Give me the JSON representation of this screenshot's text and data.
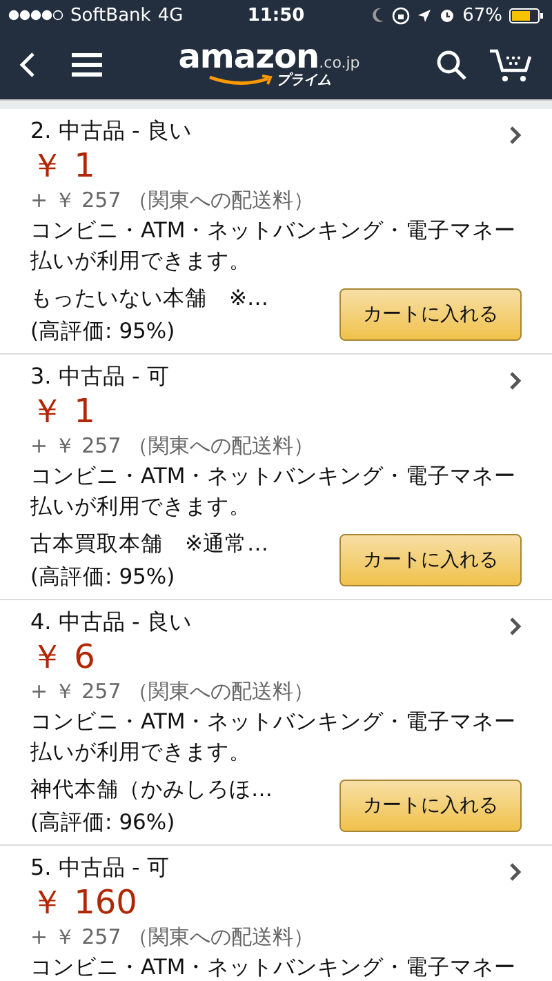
{
  "status_bar": {
    "carrier": "SoftBank",
    "network": "4G",
    "time": "11:50",
    "battery": "67%"
  },
  "nav": {
    "logo": "amazon",
    "logo_suffix": ".co.jp",
    "logo_sub": "プライム"
  },
  "listings": [
    {
      "title": "2. 中古品 - 良い",
      "price": "￥ 1",
      "shipping": "+ ￥ 257 （関東への配送料）",
      "payment_lines": [
        "コンビニ・ATM・ネットバンキング・電子マネー",
        "払いが利用できます。"
      ],
      "seller": "もったいない本舗　※…",
      "rating": "(高評価: 95%)",
      "button": "カートに入れる"
    },
    {
      "title": "3. 中古品 - 可",
      "price": "￥ 1",
      "shipping": "+ ￥ 257 （関東への配送料）",
      "payment_lines": [
        "コンビニ・ATM・ネットバンキング・電子マネー",
        "払いが利用できます。"
      ],
      "seller": "古本買取本舗　※通常…",
      "rating": "(高評価: 95%)",
      "button": "カートに入れる"
    },
    {
      "title": "4. 中古品 - 良い",
      "price": "￥ 6",
      "shipping": "+ ￥ 257 （関東への配送料）",
      "payment_lines": [
        "コンビニ・ATM・ネットバンキング・電子マネー",
        "払いが利用できます。"
      ],
      "seller": "神代本舗（かみしろほ…",
      "rating": "(高評価: 96%)",
      "button": "カートに入れる"
    },
    {
      "title": "5. 中古品 - 可",
      "price": "￥ 160",
      "shipping": "+ ￥ 257 （関東への配送料）",
      "payment_lines": [
        "コンビニ・ATM・ネットバンキング・電子マネー"
      ]
    }
  ]
}
